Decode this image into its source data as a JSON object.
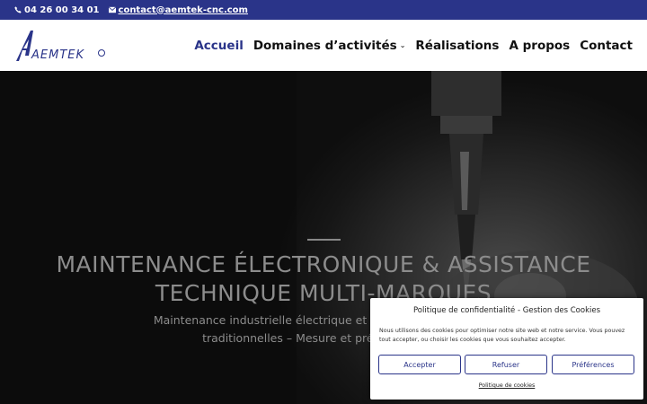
{
  "topbar": {
    "phone": "04 26 00 34 01",
    "email": "contact@aemtek-cnc.com",
    "phone_icon": "phone-icon",
    "email_icon": "envelope-icon"
  },
  "header": {
    "logo_text": "AEMTEK",
    "nav": [
      {
        "label": "Accueil",
        "active": true
      },
      {
        "label": "Domaines d’activités",
        "dropdown": true
      },
      {
        "label": "Réalisations"
      },
      {
        "label": "A propos"
      },
      {
        "label": "Contact"
      }
    ],
    "dropdown_icon": "chevron-down-icon"
  },
  "hero": {
    "title_line1": "MAINTENANCE ÉLECTRONIQUE & ASSISTANCE",
    "title_line2": "TECHNIQUE MULTI-MARQUES",
    "subtitle_line1": "Maintenance industrielle électrique et électronique – Machin",
    "subtitle_line2": "traditionnelles – Mesure et précision – Asse"
  },
  "cookie": {
    "title": "Politique de confidentialité - Gestion des Cookies",
    "text": "Nous utilisons des cookies pour optimiser notre site web et notre service. Vous pouvez tout accepter, ou choisir les cookies que vous souhaitez accepter.",
    "accept": "Accepter",
    "refuse": "Refuser",
    "preferences": "Préférences",
    "policy_link": "Politique de cookies"
  },
  "colors": {
    "brand": "#2a3489",
    "nav_text": "#111111",
    "hero_text": "#8c8c8c"
  }
}
